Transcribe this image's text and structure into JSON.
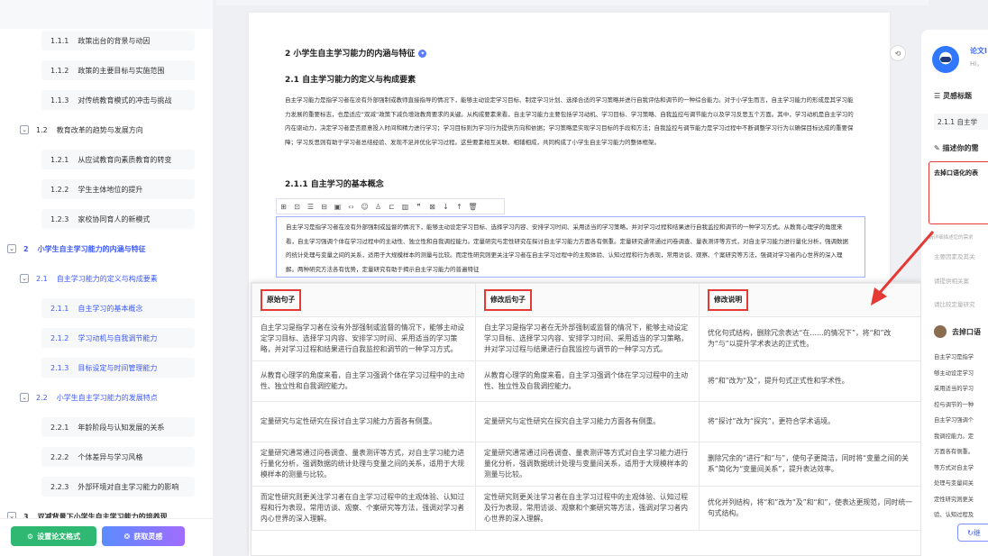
{
  "sidebar": {
    "toc": [
      {
        "level": 3,
        "num": "1.1.1",
        "label": "政策出台的背景与动因",
        "top": 0
      },
      {
        "level": 3,
        "num": "1.1.2",
        "label": "政策的主要目标与实施范围"
      },
      {
        "level": 3,
        "num": "1.1.3",
        "label": "对传统教育模式的冲击与挑战"
      },
      {
        "level": 2,
        "num": "1.2",
        "label": "教育改革的趋势与发展方向"
      },
      {
        "level": 3,
        "num": "1.2.1",
        "label": "从应试教育向素质教育的转变"
      },
      {
        "level": 3,
        "num": "1.2.2",
        "label": "学生主体地位的提升"
      },
      {
        "level": 3,
        "num": "1.2.3",
        "label": "家校协同育人的新模式"
      },
      {
        "level": 1,
        "num": "2",
        "label": "小学生自主学习能力的内涵与特征"
      },
      {
        "level": 2,
        "num": "2.1",
        "label": "自主学习能力的定义与构成要素"
      },
      {
        "level": 3,
        "num": "2.1.1",
        "label": "自主学习的基本概念"
      },
      {
        "level": 3,
        "num": "2.1.2",
        "label": "学习动机与自我调节能力"
      },
      {
        "level": 3,
        "num": "2.1.3",
        "label": "目标设定与时间管理能力"
      },
      {
        "level": 2,
        "num": "2.2",
        "label": "小学生自主学习能力的发展特点"
      },
      {
        "level": 3,
        "num": "2.2.1",
        "label": "年龄阶段与认知发展的关系"
      },
      {
        "level": 3,
        "num": "2.2.2",
        "label": "个体差异与学习风格"
      },
      {
        "level": 3,
        "num": "2.2.3",
        "label": "外部环境对自主学习能力的影响"
      },
      {
        "level": 1,
        "num": "3",
        "label": "双减背景下小学生自主学习能力的培养现"
      }
    ],
    "format_button": "设置论文格式",
    "inspire_button": "获取灵感"
  },
  "doc": {
    "h2": "2 小学生自主学习能力的内涵与特征",
    "h21": "2.1 自主学习能力的定义与构成要素",
    "para1": "自主学习能力是指学习者在没有外部强制或教师直接指导的情况下，能够主动设定学习目标、制定学习计划、选择合适的学习策略并进行自我评估和调节的一种综合能力。对于小学生而言，自主学习能力的形成是其学习能力发展的重要标志，也是适应“双减”政策下减负增效教育要求的关键。从构成要素来看，自主学习能力主要包括学习动机、学习目标、学习策略、自我监控与调节能力以及学习反思五个方面。其中，学习动机是自主学习的内在驱动力，决定学习者是否愿意投入时间和精力进行学习；学习目标则为学习行为提供方向和依据；学习策略是实现学习目标的手段和方法；自我监控与调节能力是学习过程中不断调整学习行为以确保目标达成的重要保障；学习反思则有助于学习者总结经验、发现不足并优化学习过程。这些要素相互关联、相辅相成，共同构成了小学生自主学习能力的整体框架。",
    "h211": "2.1.1 自主学习的基本概念",
    "toolbar_icons": [
      "⊞",
      "⊡",
      "☰",
      "⊟",
      "▣",
      "‹›",
      "☺",
      "♙",
      "⊏",
      "▥",
      "❞",
      "⊠",
      "↓",
      "↑",
      "🗑"
    ],
    "para2": "自主学习是指学习者在没有外部强制或监督的情况下，能够主动设定学习目标、选择学习内容、安排学习时间、采用适当的学习策略，并对学习过程和结果进行自我监控和调节的一种学习方式。从教育心理学的角度来看，自主学习强调个体在学习过程中的主动性、独立性和自我调控能力。定量研究与定性研究在探讨自主学习能力方面各有侧重。定量研究通常通过问卷调查、量表测评等方式，对自主学习能力进行量化分析，强调数据的统计处理与变量之间的关系，适用于大规模样本的测量与比较。而定性研究则更关注学习者在自主学习过程中的主观体验、认知过程和行为表现，常用访谈、观察、个案研究等方法，强调对学习者内心世界的深入理解。两种研究方法各有优势，定量研究有助于揭示自主学习能力的普遍特征"
  },
  "table": {
    "headers": [
      "原始句子",
      "修改后句子",
      "修改说明"
    ],
    "rows": [
      [
        "自主学习是指学习者在没有外部强制或监督的情况下，能够主动设定学习目标、选择学习内容、安排学习时间、采用适当的学习策略，并对学习过程和结果进行自我监控和调节的一种学习方式。",
        "自主学习是指学习者在无外部强制或监督的情况下，能够主动设定学习目标、选择学习内容、安排学习时间、采用适当的学习策略，并对学习过程与结果进行自我监控与调节的一种学习方式。",
        "优化句式结构，删除冗余表达“在……的情况下”，将“和”改为“与”以提升学术表达的正式性。"
      ],
      [
        "从教育心理学的角度来看，自主学习强调个体在学习过程中的主动性、独立性和自我调控能力。",
        "从教育心理学的角度来看，自主学习强调个体在学习过程中的主动性、独立性及自我调控能力。",
        "将“和”改为“及”，提升句式正式性和学术性。"
      ],
      [
        "定量研究与定性研究在探讨自主学习能力方面各有侧重。",
        "定量研究与定性研究在探究自主学习能力方面各有侧重。",
        "将“探讨”改为“探究”，更符合学术语境。"
      ],
      [
        "定量研究通常通过问卷调查、量表测评等方式，对自主学习能力进行量化分析，强调数据的统计处理与变量之间的关系，适用于大规模样本的测量与比较。",
        "定量研究通常通过问卷调查、量表测评等方式对自主学习能力进行量化分析，强调数据统计处理与变量间关系，适用于大规模样本的测量与比较。",
        "删除冗余的“进行”和“与”，使句子更简洁，同时将“变量之间的关系”简化为“变量间关系”，提升表达效率。"
      ],
      [
        "而定性研究则更关注学习者在自主学习过程中的主观体验、认知过程和行为表现，常用访谈、观察、个案研究等方法，强调对学习者内心世界的深入理解。",
        "定性研究则更关注学习者在自主学习过程中的主观体验、认知过程及行为表现，常用访谈、观察和个案研究等方法，强调对学习者内心世界的深入理解。",
        "优化并列结构，将“和”改为“及”和“和”，使表达更规范，同时统一句式结构。"
      ]
    ]
  },
  "rpanel": {
    "title": "论文I",
    "hi": "Hi，",
    "inspire_label": "灵感标题",
    "inspire_value": "2.1.1 自主学",
    "desc_label": "描述你的需",
    "input_value": "去掉口语化的表",
    "ph1": "请详细描述您的需求",
    "ph2": "主要因素及其关",
    "ph3": "请提供相关案",
    "ph4": "请比较定量研究",
    "result_title": "去掉口语",
    "result_lines": [
      "自主学习是指学",
      "够主动设定学习",
      "采用适当的学习",
      "控与调节的一种",
      "自主学习强调个",
      "我调控能力。定",
      "方面各有侧重。",
      "等方式对自主学",
      "处理与变量间关",
      "定性研究则更关",
      "验、认知过程及"
    ],
    "button": "继"
  },
  "colors": {
    "accent": "#3d5afe",
    "highlight": "#e53935",
    "green": "#2eb872"
  }
}
